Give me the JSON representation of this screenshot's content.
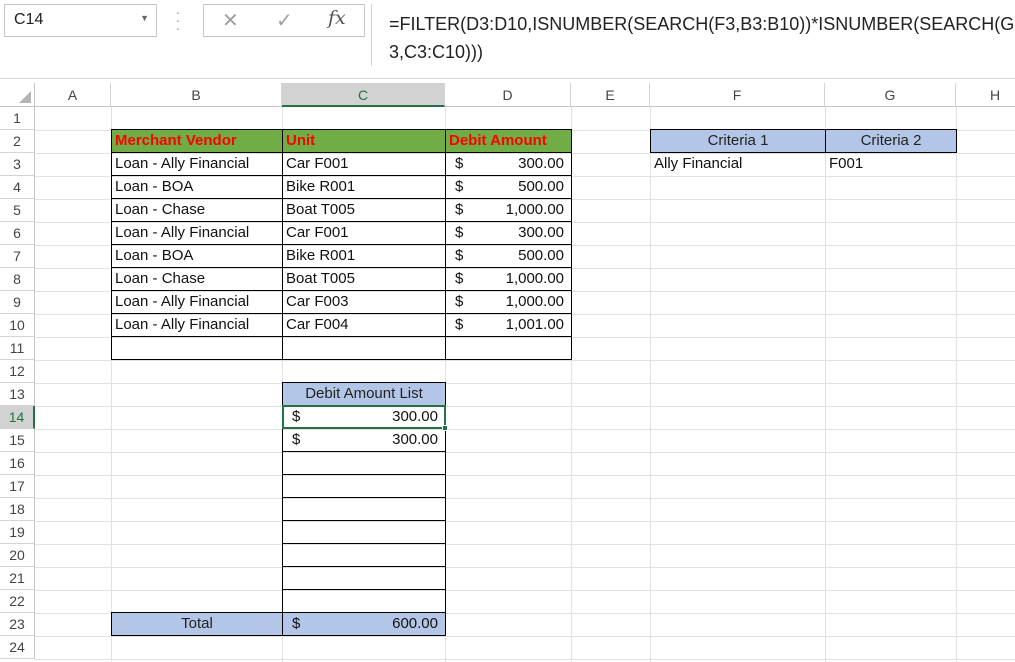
{
  "name_box": {
    "value": "C14"
  },
  "formula_bar": {
    "cancel_icon": "close-icon",
    "enter_icon": "check-icon",
    "fx_label": "fx",
    "formula": "=FILTER(D3:D10,ISNUMBER(SEARCH(F3,B3:B10))*ISNUMBER(SEARCH(G3,C3:C10)))"
  },
  "columns": [
    "A",
    "B",
    "C",
    "D",
    "E",
    "F",
    "G",
    "H"
  ],
  "rows": [
    "1",
    "2",
    "3",
    "4",
    "5",
    "6",
    "7",
    "8",
    "9",
    "10",
    "11",
    "12",
    "13",
    "14",
    "15",
    "16",
    "17",
    "18",
    "19",
    "20",
    "21",
    "22",
    "23",
    "24"
  ],
  "selected": {
    "column": "C",
    "row": "14"
  },
  "data_table": {
    "headers": {
      "vendor": "Merchant  Vendor",
      "unit": "Unit",
      "amount": "Debit Amount"
    },
    "rows": [
      {
        "vendor": "Loan - Ally Financial",
        "unit": "Car F001",
        "currency": "$",
        "amount": "300.00"
      },
      {
        "vendor": "Loan - BOA",
        "unit": "Bike R001",
        "currency": "$",
        "amount": "500.00"
      },
      {
        "vendor": "Loan - Chase",
        "unit": "Boat T005",
        "currency": "$",
        "amount": "1,000.00"
      },
      {
        "vendor": "Loan - Ally Financial",
        "unit": "Car F001",
        "currency": "$",
        "amount": "300.00"
      },
      {
        "vendor": "Loan - BOA",
        "unit": "Bike R001",
        "currency": "$",
        "amount": "500.00"
      },
      {
        "vendor": "Loan - Chase",
        "unit": "Boat T005",
        "currency": "$",
        "amount": "1,000.00"
      },
      {
        "vendor": "Loan - Ally Financial",
        "unit": "Car F003",
        "currency": "$",
        "amount": "1,000.00"
      },
      {
        "vendor": "Loan - Ally Financial",
        "unit": "Car F004",
        "currency": "$",
        "amount": "1,001.00"
      }
    ]
  },
  "criteria": {
    "header1": "Criteria 1",
    "header2": "Criteria 2",
    "value1": "Ally Financial",
    "value2": "F001"
  },
  "debit_list": {
    "header": "Debit Amount List",
    "rows": [
      {
        "currency": "$",
        "amount": "300.00"
      },
      {
        "currency": "$",
        "amount": "300.00"
      }
    ],
    "total_label": "Total",
    "total_currency": "$",
    "total_amount": "600.00"
  },
  "colors": {
    "header_green": "#70ad47",
    "header_red_text": "#ff0000",
    "header_blue": "#b4c6e7",
    "selection": "#217346"
  }
}
